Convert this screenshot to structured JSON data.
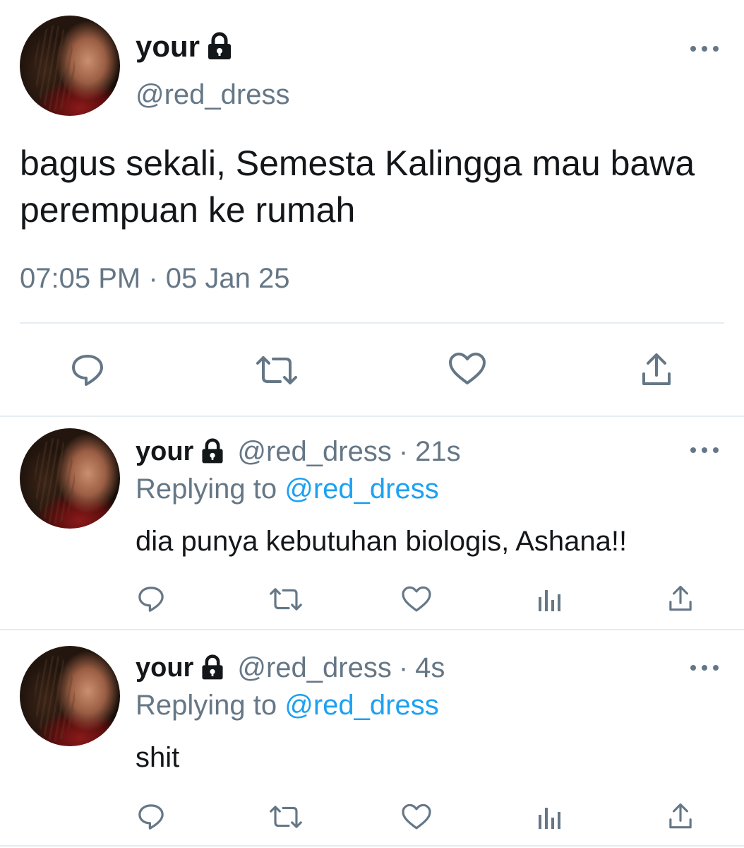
{
  "main_tweet": {
    "display_name": "your",
    "handle": "@red_dress",
    "text": "bagus sekali, Semesta Kalingga mau bawa perempuan ke rumah",
    "time": "07:05 PM",
    "separator": "·",
    "date": "05 Jan 25",
    "icons": [
      "lock-icon",
      "more-icon",
      "reply-icon",
      "retweet-icon",
      "like-icon",
      "share-icon"
    ]
  },
  "replies": [
    {
      "display_name": "your",
      "handle": "@red_dress",
      "separator": "·",
      "age": "21s",
      "replying_prefix": "Replying to",
      "replying_to": "@red_dress",
      "text": "dia punya kebutuhan biologis, Ashana!!"
    },
    {
      "display_name": "your",
      "handle": "@red_dress",
      "separator": "·",
      "age": "4s",
      "replying_prefix": "Replying to",
      "replying_to": "@red_dress",
      "text": "shit"
    }
  ],
  "colors": {
    "text": "#14171a",
    "secondary": "#657786",
    "link": "#1da1f2",
    "divider": "#e6ecf0"
  }
}
